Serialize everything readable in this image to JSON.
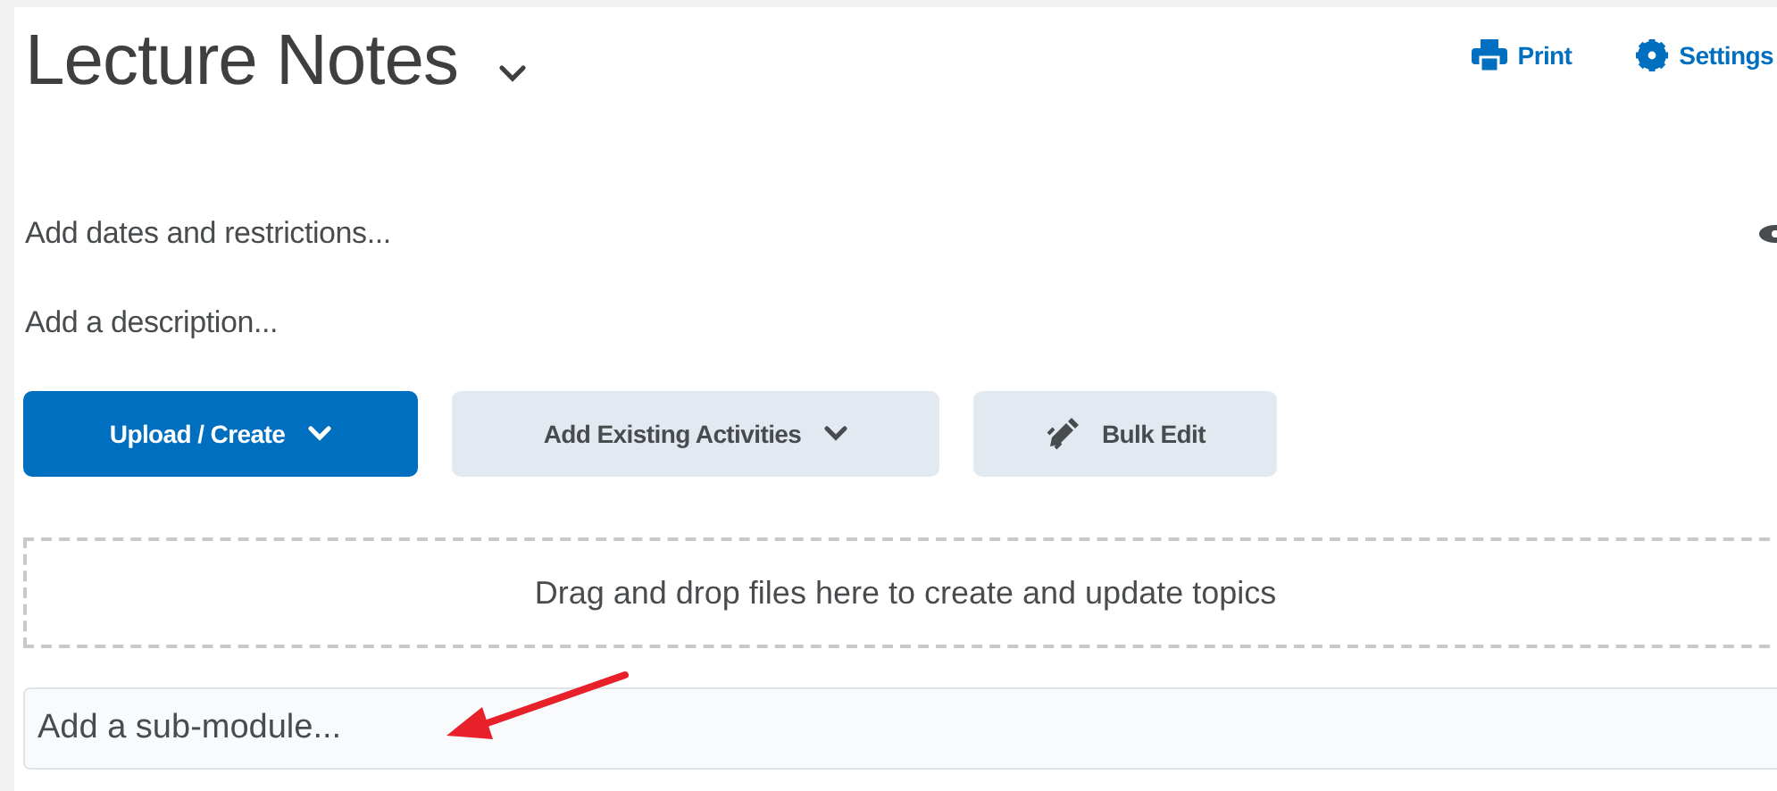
{
  "header": {
    "title": "Lecture Notes",
    "actions": [
      {
        "kind": "print",
        "label": "Print"
      },
      {
        "kind": "settings",
        "label": "Settings"
      }
    ]
  },
  "dates_link": "Add dates and restrictions...",
  "description_link": "Add a description...",
  "buttons": [
    {
      "kind": "primary-dropdown",
      "label": "Upload / Create"
    },
    {
      "kind": "dropdown",
      "label": "Add Existing Activities"
    },
    {
      "kind": "edit",
      "label": "Bulk Edit"
    }
  ],
  "dropzone": "Drag and drop files here to create and update topics",
  "submodule": {
    "placeholder": "Add a sub-module..."
  },
  "annotation": {
    "kind": "arrow"
  }
}
